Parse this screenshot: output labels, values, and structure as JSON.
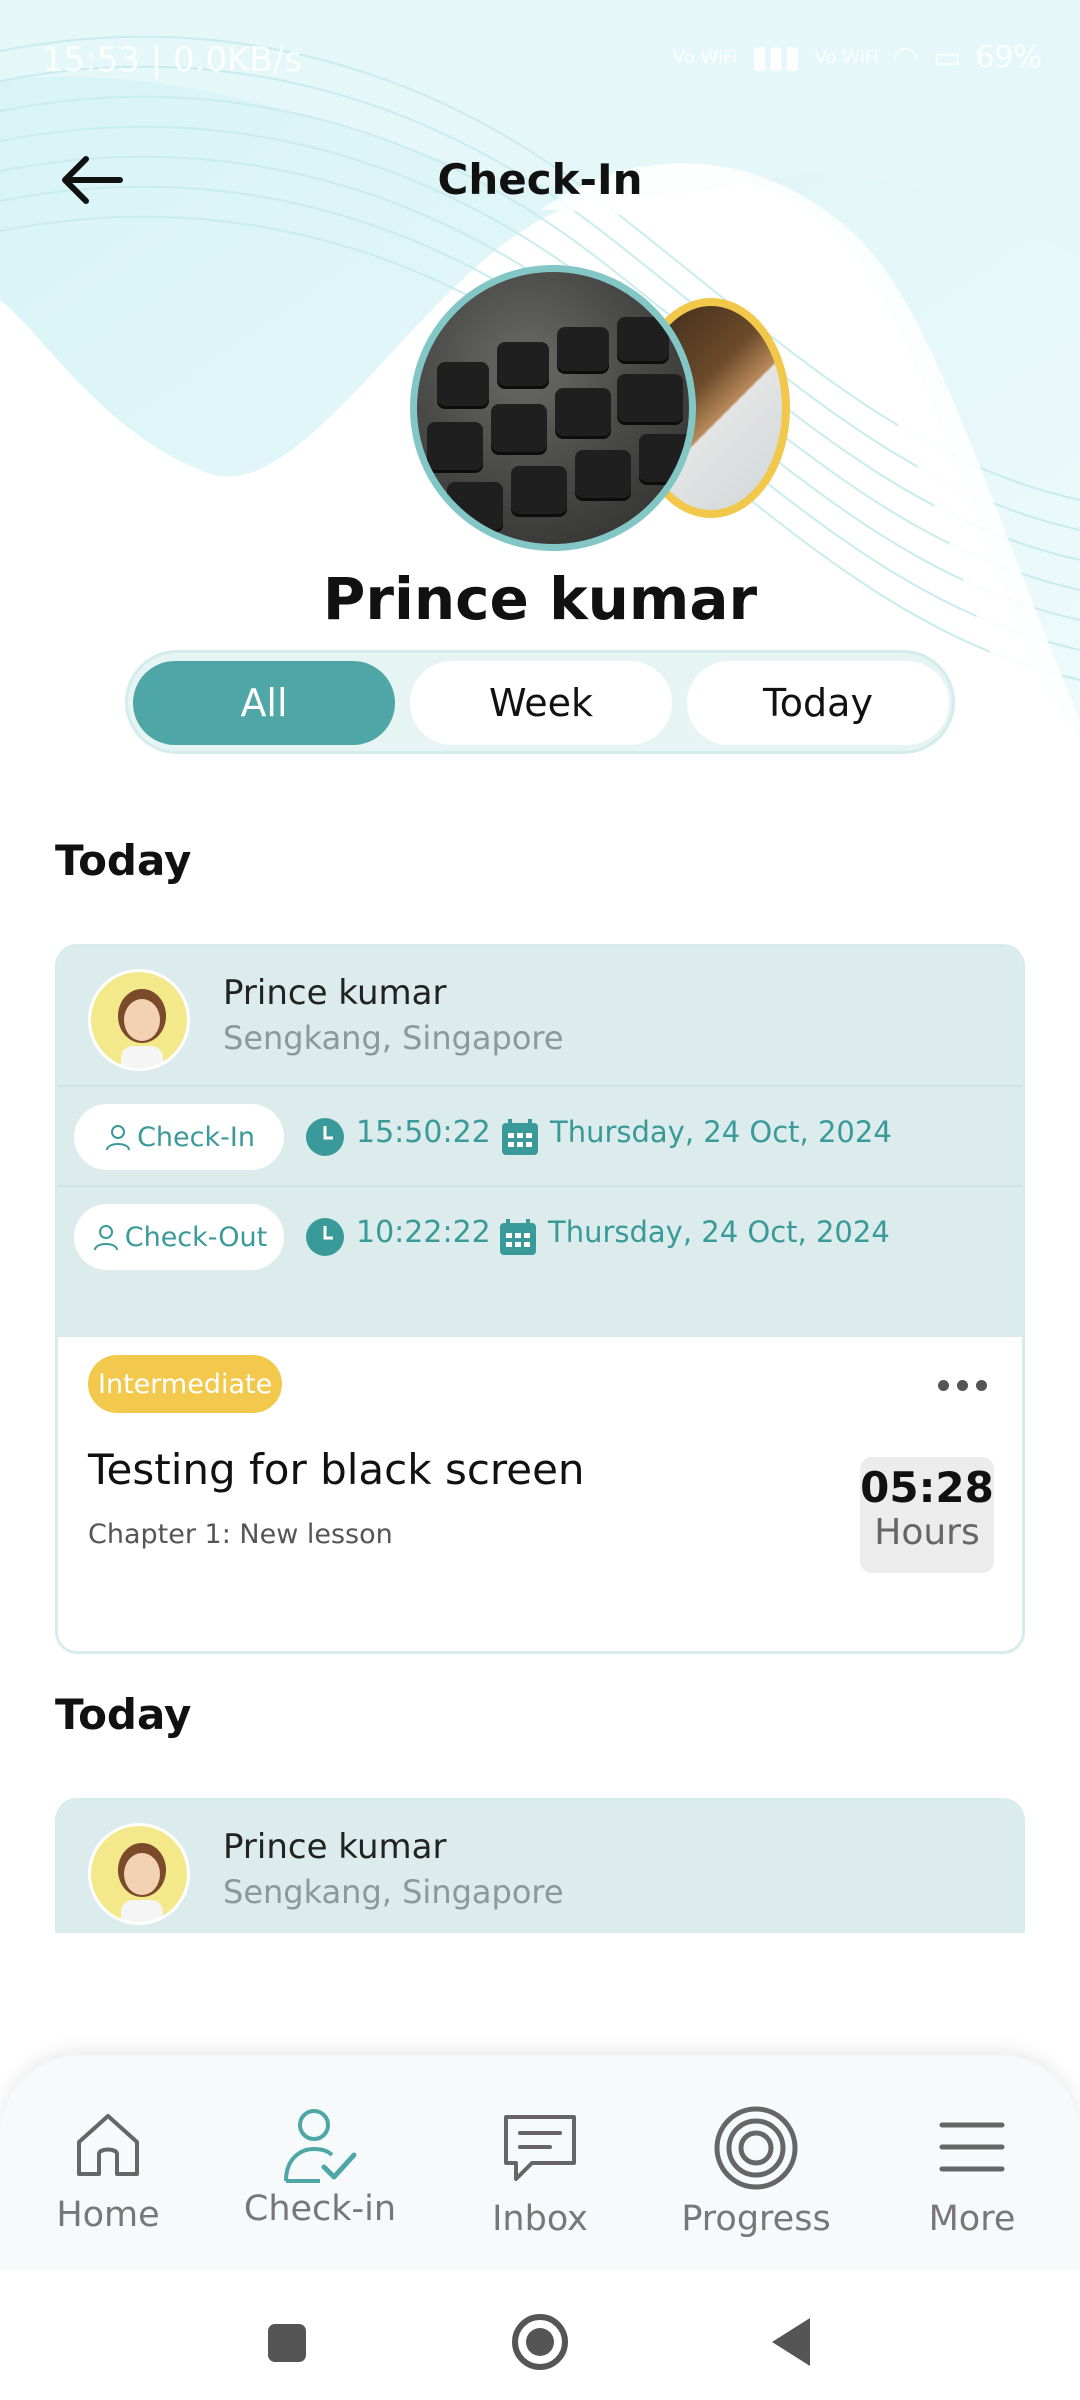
{
  "status_bar": {
    "time_speed": "15:53 | 0.0KB/s",
    "network_1": "Vo WiFi",
    "network_2": "Vo WiFi",
    "battery": "69%"
  },
  "header": {
    "title": "Check-In",
    "back_icon": "arrow-left-icon"
  },
  "profile": {
    "name": "Prince kumar"
  },
  "filters": {
    "tabs": [
      {
        "label": "All",
        "active": true
      },
      {
        "label": "Week",
        "active": false
      },
      {
        "label": "Today",
        "active": false
      }
    ]
  },
  "sections": [
    {
      "title": "Today",
      "card": {
        "user_name": "Prince kumar",
        "location": "Sengkang, Singapore",
        "check_in": {
          "label": "Check-In",
          "time": "15:50:22",
          "date": "Thursday, 24 Oct, 2024"
        },
        "check_out": {
          "label": "Check-Out",
          "time": "10:22:22",
          "date": "Thursday, 24 Oct, 2024"
        },
        "level": "Intermediate",
        "lesson_title": "Testing for black screen",
        "lesson_subtitle": "Chapter 1: New lesson",
        "hours_value": "05:28",
        "hours_label": "Hours"
      }
    },
    {
      "title": "Today",
      "card": {
        "user_name": "Prince kumar",
        "location": "Sengkang, Singapore"
      }
    }
  ],
  "bottom_nav": {
    "items": [
      {
        "label": "Home",
        "icon": "home-icon"
      },
      {
        "label": "Check-in",
        "icon": "check-in-user-icon"
      },
      {
        "label": "Inbox",
        "icon": "chat-icon"
      },
      {
        "label": "Progress",
        "icon": "target-icon"
      },
      {
        "label": "More",
        "icon": "menu-icon"
      }
    ]
  },
  "colors": {
    "accent": "#4ea6a6",
    "accent_text": "#3a9a9a",
    "card_top_bg": "#dcecec",
    "badge_yellow": "#f2c94c"
  }
}
